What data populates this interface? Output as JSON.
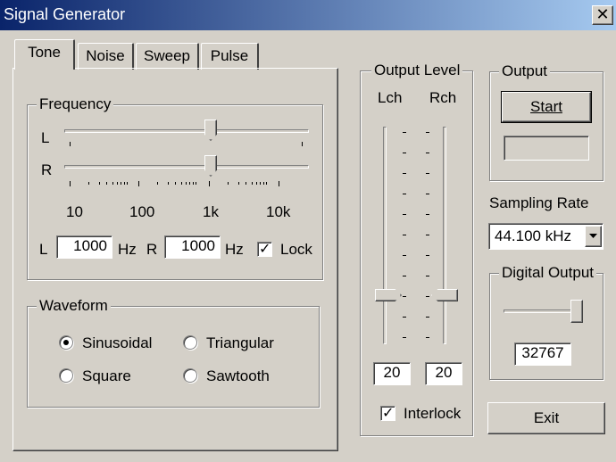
{
  "window": {
    "title": "Signal Generator"
  },
  "tabs": [
    {
      "label": "Tone"
    },
    {
      "label": "Noise"
    },
    {
      "label": "Sweep"
    },
    {
      "label": "Pulse"
    }
  ],
  "frequency": {
    "group_label": "Frequency",
    "l_label": "L",
    "r_label": "R",
    "slider_l_fraction": 0.6,
    "slider_r_fraction": 0.6,
    "scale_labels": [
      "10",
      "100",
      "1k",
      "10k"
    ],
    "l_field_label": "L",
    "l_value": "1000",
    "l_unit": "Hz",
    "r_field_label": "R",
    "r_value": "1000",
    "r_unit": "Hz",
    "lock_label": "Lock",
    "lock_checked": true
  },
  "waveform": {
    "group_label": "Waveform",
    "options": [
      {
        "label": "Sinusoidal",
        "selected": true
      },
      {
        "label": "Triangular",
        "selected": false
      },
      {
        "label": "Square",
        "selected": false
      },
      {
        "label": "Sawtooth",
        "selected": false
      }
    ]
  },
  "output_level": {
    "group_label": "Output Level",
    "lch_label": "Lch",
    "rch_label": "Rch",
    "lch_value": "20",
    "rch_value": "20",
    "lch_fraction": 0.2,
    "rch_fraction": 0.2,
    "interlock_label": "Interlock",
    "interlock_checked": true
  },
  "output": {
    "group_label": "Output",
    "start_label": "Start",
    "status_value": ""
  },
  "sampling": {
    "label": "Sampling Rate",
    "selected": "44.100 kHz"
  },
  "digital_output": {
    "group_label": "Digital Output",
    "slider_fraction": 1.0,
    "value": "32767"
  },
  "exit_label": "Exit"
}
